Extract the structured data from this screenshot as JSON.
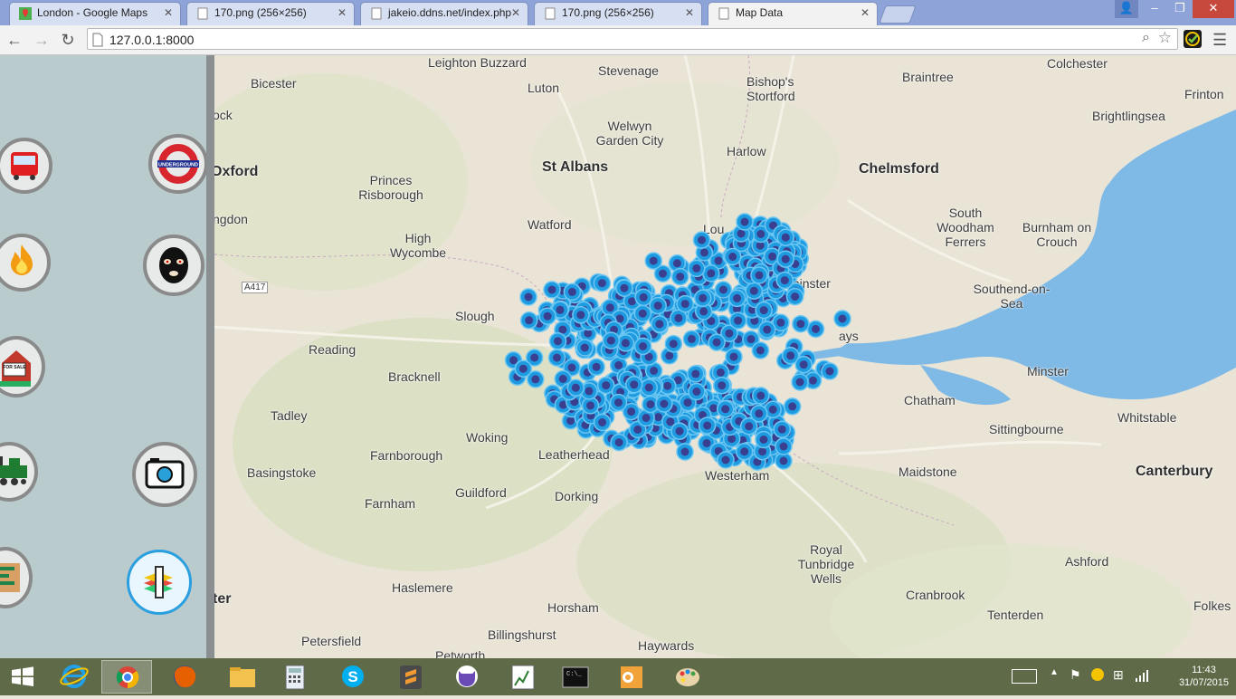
{
  "window": {
    "tabs": [
      {
        "title": "London - Google Maps",
        "active": false
      },
      {
        "title": "170.png (256×256)",
        "active": false
      },
      {
        "title": "jakeio.ddns.net/index.php",
        "active": false
      },
      {
        "title": "170.png (256×256)",
        "active": false
      },
      {
        "title": "Map Data",
        "active": true
      }
    ],
    "url": "127.0.0.1:8000"
  },
  "sidebar": {
    "buttons": [
      {
        "name": "bus-icon"
      },
      {
        "name": "underground-icon",
        "label": "UNDERGROUND"
      },
      {
        "name": "fire-icon"
      },
      {
        "name": "balaclava-icon"
      },
      {
        "name": "for-sale-icon",
        "label": "FOR SALE"
      },
      {
        "name": "camera-icon"
      },
      {
        "name": "train-icon"
      },
      {
        "name": "info-icon"
      },
      {
        "name": "map-icon"
      }
    ]
  },
  "map": {
    "labels": [
      "Leighton Buzzard",
      "Stevenage",
      "Bishop's Stortford",
      "Braintree",
      "Colchester",
      "Frinton",
      "Luton",
      "Bicester",
      "Brightlingsea",
      "Welwyn Garden City",
      "Harlow",
      "Oxford",
      "St Albans",
      "Chelmsford",
      "Princes Risborough",
      "South Woodham Ferrers",
      "Burnham on Crouch",
      "Watford",
      "High Wycombe",
      "Southend-on-Sea",
      "Slough",
      "Reading",
      "Bracknell",
      "Minster",
      "Chatham",
      "Tadley",
      "Sittingbourne",
      "Whitstable",
      "Woking",
      "Leatherhead",
      "Westerham",
      "Farnborough",
      "Basingstoke",
      "Maidstone",
      "Canterbury",
      "Guildford",
      "Dorking",
      "Farnham",
      "Royal Tunbridge Wells",
      "Ashford",
      "Haslemere",
      "Cranbrook",
      "Horsham",
      "Tenterden",
      "Folkes",
      "Petersfield",
      "Billingshurst",
      "Haywards",
      "Petworth",
      "A417",
      "ngdon",
      "ock",
      "ter",
      "Lou",
      "Ilminster",
      "ays"
    ],
    "marker_color": "#1e9be0",
    "marker_center": "#3b3f8f"
  },
  "taskbar": {
    "time": "11:43",
    "date": "31/07/2015"
  }
}
